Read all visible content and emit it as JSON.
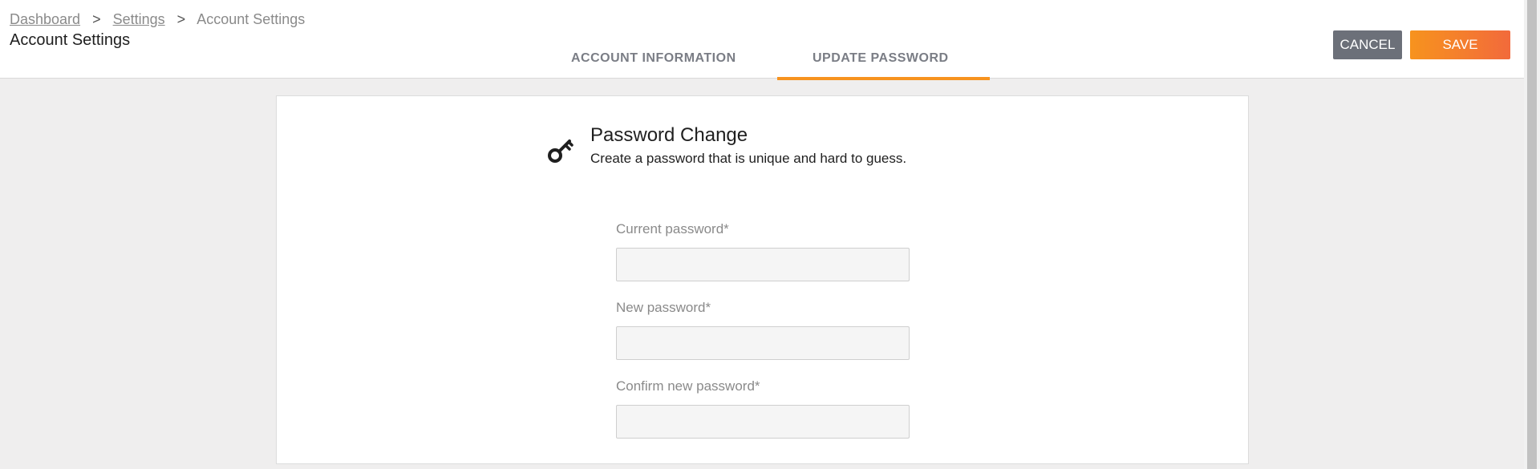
{
  "breadcrumb": {
    "items": [
      "Dashboard",
      "Settings"
    ],
    "current": "Account Settings",
    "separator": ">"
  },
  "page": {
    "title": "Account Settings"
  },
  "tabs": [
    {
      "label": "ACCOUNT INFORMATION",
      "active": false
    },
    {
      "label": "UPDATE PASSWORD",
      "active": true
    }
  ],
  "actions": {
    "cancel_label": "CANCEL",
    "save_label": "SAVE"
  },
  "section": {
    "icon": "key-icon",
    "title": "Password Change",
    "subtitle": "Create a password that is unique and hard to guess."
  },
  "fields": [
    {
      "label": "Current password*",
      "value": "",
      "placeholder": ""
    },
    {
      "label": "New password*",
      "value": "",
      "placeholder": ""
    },
    {
      "label": "Confirm new password*",
      "value": "",
      "placeholder": ""
    }
  ],
  "colors": {
    "accent": "#f7931e",
    "cancel": "#6c7079"
  }
}
